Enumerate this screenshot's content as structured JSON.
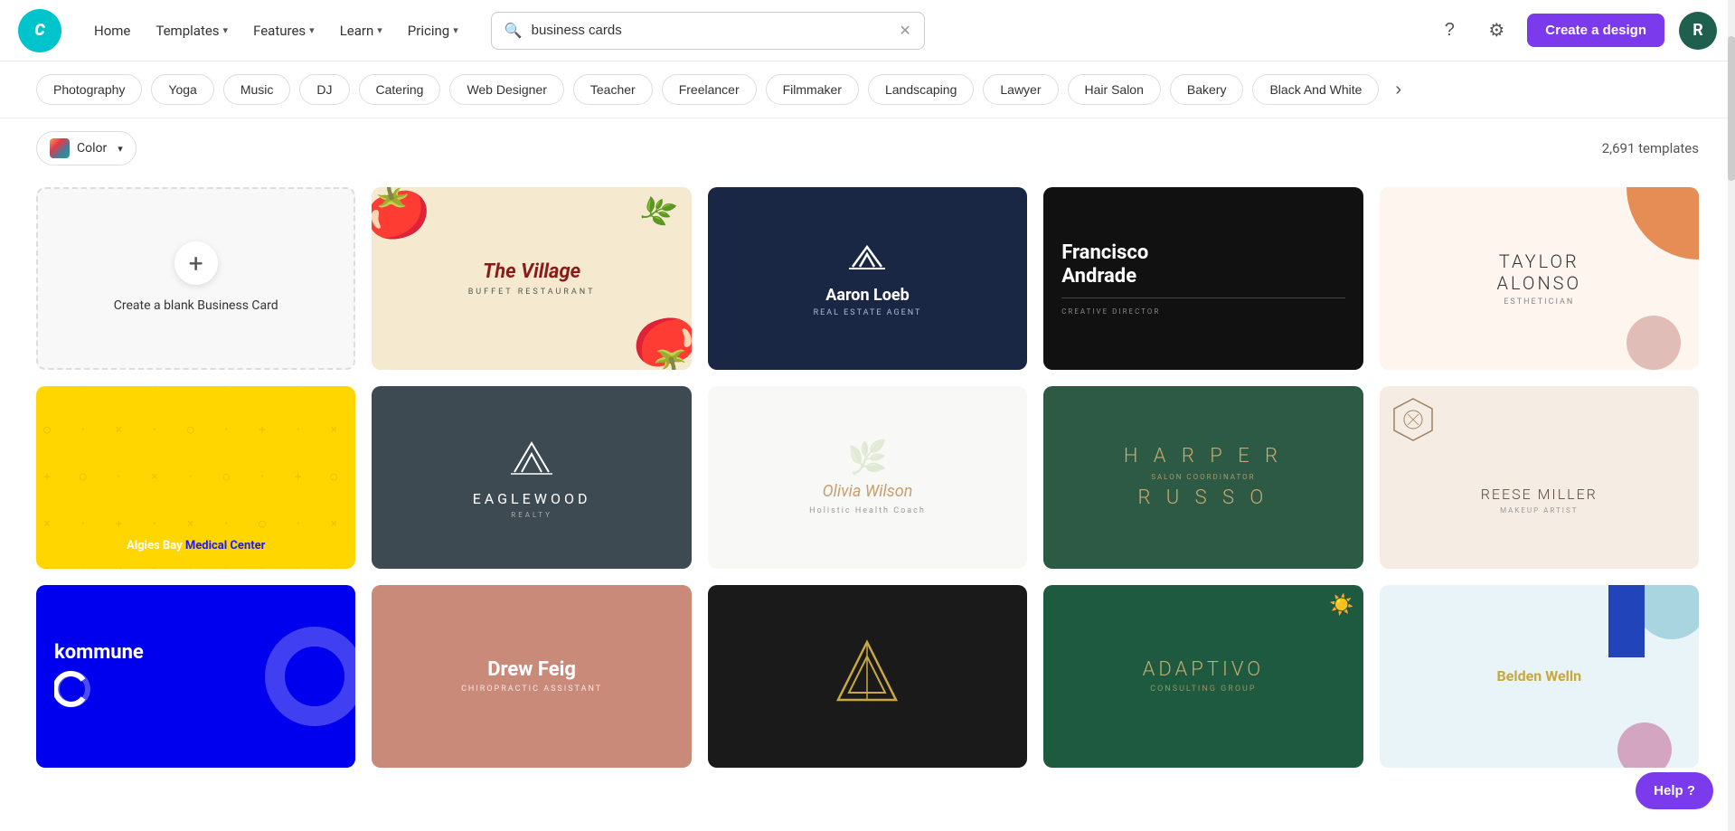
{
  "nav": {
    "logo_text": "C",
    "home": "Home",
    "templates": "Templates",
    "features": "Features",
    "learn": "Learn",
    "pricing": "Pricing",
    "search_value": "business cards",
    "search_placeholder": "Search",
    "create_btn": "Create a design",
    "avatar_initial": "R",
    "help_btn": "Help ?"
  },
  "filter_tags": [
    "Photography",
    "Yoga",
    "Music",
    "DJ",
    "Catering",
    "Web Designer",
    "Teacher",
    "Freelancer",
    "Filmmaker",
    "Landscaping",
    "Lawyer",
    "Hair Salon",
    "Bakery",
    "Black And White"
  ],
  "toolbar": {
    "color_label": "Color",
    "templates_count": "2,691 templates"
  },
  "blank_card": {
    "label": "Create a blank Business Card"
  },
  "templates": [
    {
      "id": "village",
      "name": "The Village",
      "sub": "BUFFET RESTAURANT",
      "style": "village"
    },
    {
      "id": "aaron",
      "name": "Aaron Loeb",
      "role": "REAL ESTATE AGENT",
      "style": "aaron"
    },
    {
      "id": "francisco",
      "name": "Francisco Andrade",
      "role": "CREATIVE DIRECTOR",
      "style": "francisco"
    },
    {
      "id": "taylor",
      "name": "TAYLOR ALONSO",
      "role": "ESTHETICIAN",
      "style": "taylor"
    },
    {
      "id": "algies",
      "name": "Algies Bay Medical Center",
      "style": "algies"
    },
    {
      "id": "eaglewood",
      "name": "EAGLEWOOD",
      "sub": "REALTY",
      "style": "eaglewood"
    },
    {
      "id": "olivia",
      "name": "Olivia Wilson",
      "role": "Holistic Health Coach",
      "style": "olivia"
    },
    {
      "id": "harper",
      "fname": "HARPER",
      "lname": "RUSSO",
      "role": "SALON COORDINATOR",
      "style": "harper"
    },
    {
      "id": "reese",
      "name": "REESE MILLER",
      "role": "MAKEUP ARTIST",
      "style": "reese"
    },
    {
      "id": "kommune",
      "name": "kommune",
      "style": "kommune"
    },
    {
      "id": "drew",
      "name": "Drew Feig",
      "role": "CHIROPRACTIC ASSISTANT",
      "style": "drew"
    },
    {
      "id": "mv",
      "style": "mv"
    },
    {
      "id": "adaptivo",
      "name": "ADAPTIVO",
      "sub": "CONSULTING GROUP",
      "style": "adaptivo"
    },
    {
      "id": "belden",
      "name": "Belden Welln",
      "style": "belden"
    }
  ]
}
